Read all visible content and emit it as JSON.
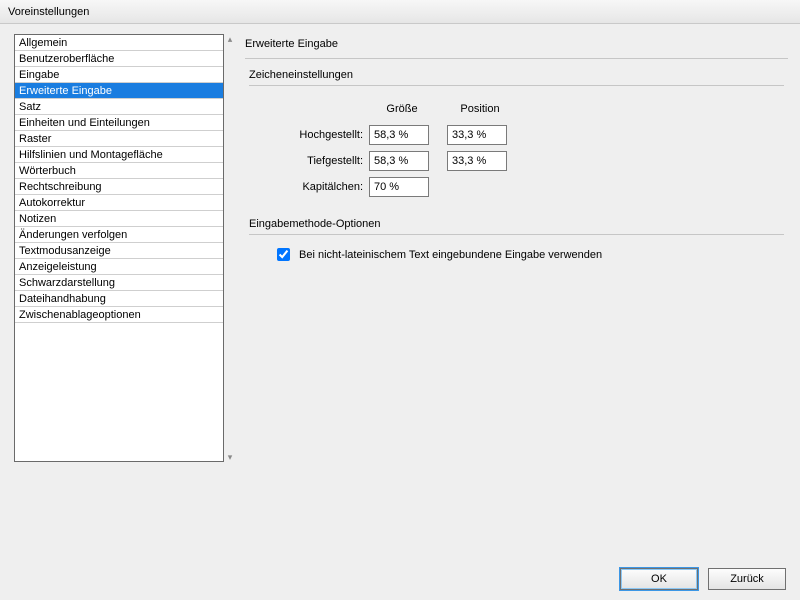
{
  "window": {
    "title": "Voreinstellungen"
  },
  "sidebar": {
    "selected_index": 3,
    "categories": [
      "Allgemein",
      "Benutzeroberfläche",
      "Eingabe",
      "Erweiterte Eingabe",
      "Satz",
      "Einheiten und Einteilungen",
      "Raster",
      "Hilfslinien und Montagefläche",
      "Wörterbuch",
      "Rechtschreibung",
      "Autokorrektur",
      "Notizen",
      "Änderungen verfolgen",
      "Textmodusanzeige",
      "Anzeigeleistung",
      "Schwarzdarstellung",
      "Dateihandhabung",
      "Zwischenablageoptionen"
    ]
  },
  "panel": {
    "title": "Erweiterte Eingabe",
    "char_settings": {
      "legend": "Zeicheneinstellungen",
      "headers": {
        "size": "Größe",
        "position": "Position"
      },
      "superscript": {
        "label": "Hochgestellt:",
        "size": "58,3 %",
        "position": "33,3 %"
      },
      "subscript": {
        "label": "Tiefgestellt:",
        "size": "58,3 %",
        "position": "33,3 %"
      },
      "smallcaps": {
        "label": "Kapitälchen:",
        "size": "70 %"
      }
    },
    "ime_options": {
      "legend": "Eingabemethode-Optionen",
      "inline_nonlatin": {
        "label": "Bei nicht-lateinischem Text eingebundene Eingabe verwenden",
        "checked": true
      }
    }
  },
  "footer": {
    "ok": "OK",
    "back": "Zurück"
  }
}
